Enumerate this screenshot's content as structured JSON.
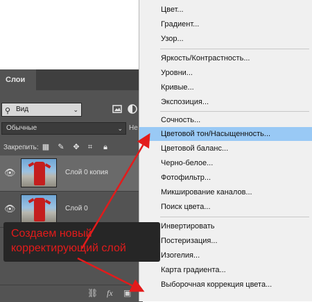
{
  "panel": {
    "tab_label": "Слои",
    "kind_label": "Вид",
    "blend_mode": "Обычные",
    "opacity_label": "Не",
    "lock_label": "Закрепить:",
    "layers": [
      {
        "name": "Слой 0 копия",
        "selected": true
      },
      {
        "name": "Слой 0",
        "selected": false
      }
    ],
    "bottom_icons": [
      "link-icon",
      "fx-icon",
      "mask-icon",
      "adjustment-layer-icon",
      "folder-icon",
      "new-layer-icon",
      "trash-icon"
    ],
    "fx_label": "fx"
  },
  "menu": {
    "items": [
      {
        "label": "Цвет..."
      },
      {
        "label": "Градиент..."
      },
      {
        "label": "Узор..."
      },
      {
        "label": "Яркость/Контрастность..."
      },
      {
        "label": "Уровни..."
      },
      {
        "label": "Кривые..."
      },
      {
        "label": "Экспозиция..."
      },
      {
        "label": "Сочность..."
      },
      {
        "label": "Цветовой тон/Насыщенность...",
        "highlighted": true
      },
      {
        "label": "Цветовой баланс..."
      },
      {
        "label": "Черно-белое..."
      },
      {
        "label": "Фотофильтр..."
      },
      {
        "label": "Микширование каналов..."
      },
      {
        "label": "Поиск цвета..."
      },
      {
        "label": "Инвертировать"
      },
      {
        "label": "Постеризация..."
      },
      {
        "label": "Изогелия..."
      },
      {
        "label": "Карта градиента..."
      },
      {
        "label": "Выборочная коррекция цвета..."
      }
    ],
    "highlight_color": "#99c9f5"
  },
  "callout": {
    "line1": "Создаем новый",
    "line2": "корректирующий слой",
    "color": "#e31b1b"
  },
  "colors": {
    "panel_bg": "#535353",
    "arrow": "#e31b1b"
  }
}
